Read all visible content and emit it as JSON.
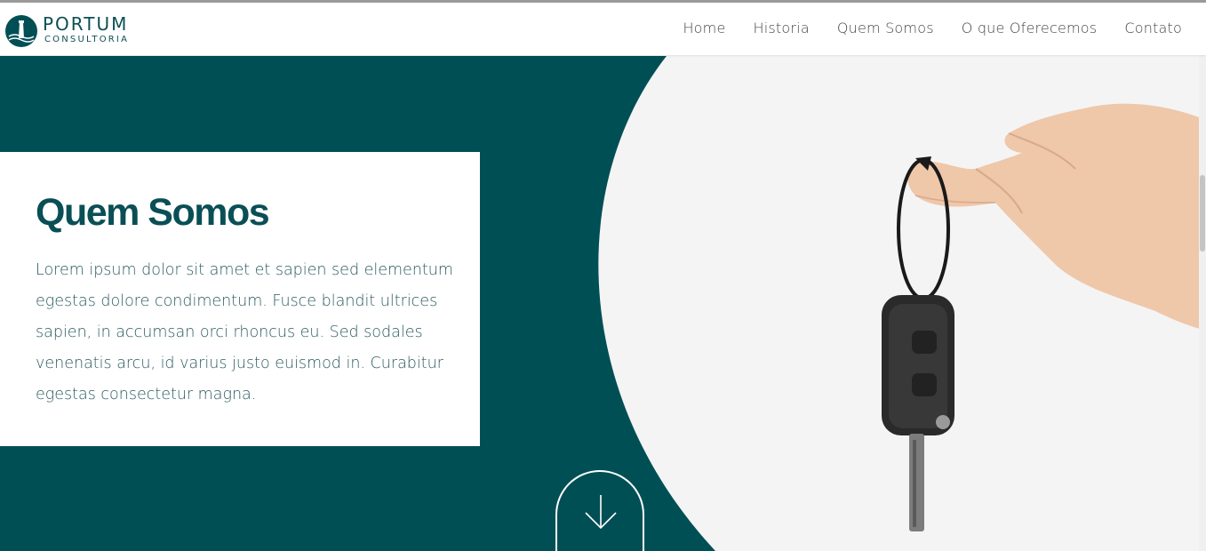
{
  "header": {
    "logo": {
      "name": "PORTUM",
      "sub": "CONSULTORIA"
    },
    "nav": [
      "Home",
      "Historia",
      "Quem Somos",
      "O que Oferecemos",
      "Contato"
    ]
  },
  "hero": {
    "title": "Quem Somos",
    "body": "Lorem ipsum dolor sit amet et sapien sed elementum egestas dolore condimentum. Fusce blandit ultrices sapien, in accumsan orci rhoncus eu. Sed sodales venenatis arcu, id varius justo euismod in. Curabitur egestas consectetur magna.",
    "scroll_icon": "arrow-down-icon",
    "image_subject": "hand holding car key"
  },
  "colors": {
    "brand_teal": "#004f55",
    "card_bg": "#ffffff",
    "photo_bg": "#f4f4f4"
  }
}
